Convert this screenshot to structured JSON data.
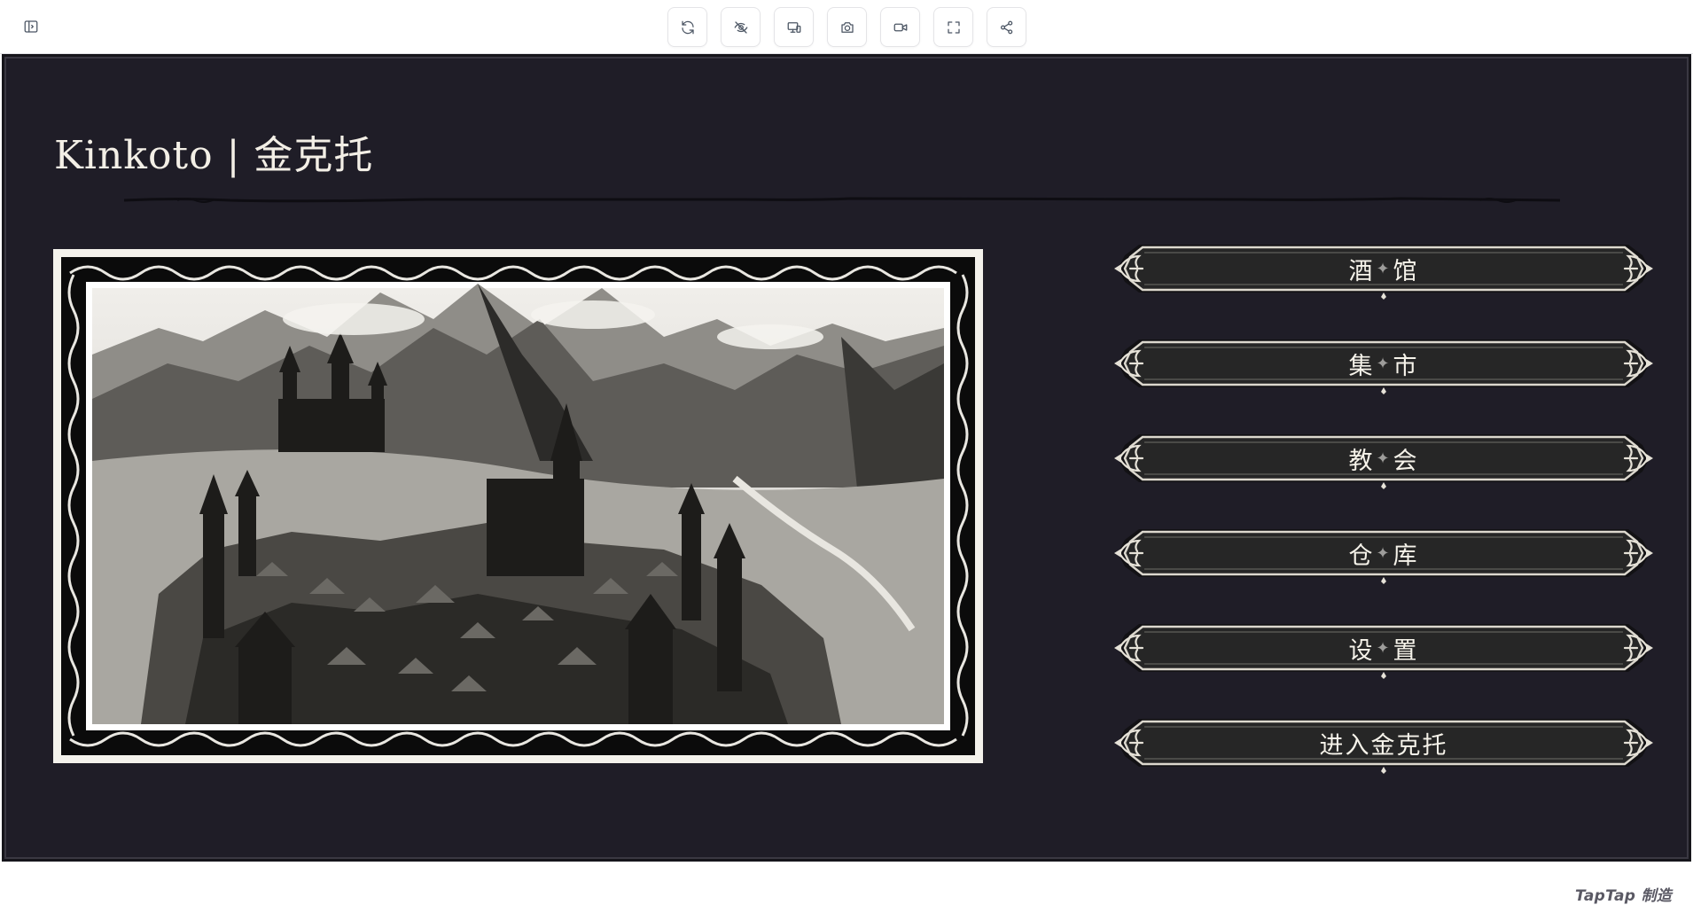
{
  "toolbar": {
    "buttons": [
      {
        "name": "refresh-button",
        "icon": "refresh-icon"
      },
      {
        "name": "hide-button",
        "icon": "eye-off-icon"
      },
      {
        "name": "device-button",
        "icon": "devices-icon"
      },
      {
        "name": "screenshot-button",
        "icon": "camera-icon"
      },
      {
        "name": "record-button",
        "icon": "video-icon"
      },
      {
        "name": "fullscreen-button",
        "icon": "fullscreen-icon"
      },
      {
        "name": "share-button",
        "icon": "share-icon"
      }
    ]
  },
  "game": {
    "title": "Kinkoto | 金克托",
    "menu": [
      {
        "left": "酒",
        "right": "馆"
      },
      {
        "left": "集",
        "right": "市"
      },
      {
        "left": "教",
        "right": "会"
      },
      {
        "left": "仓",
        "right": "库"
      },
      {
        "left": "设",
        "right": "置"
      },
      {
        "label": "进入金克托"
      }
    ],
    "separator": "✦",
    "watermark": "TapTap 制造"
  },
  "colors": {
    "stage_bg": "#1f1d27",
    "button_bg": "#262626",
    "button_border": "#d9d6cc",
    "title_text": "#f3efe6"
  }
}
